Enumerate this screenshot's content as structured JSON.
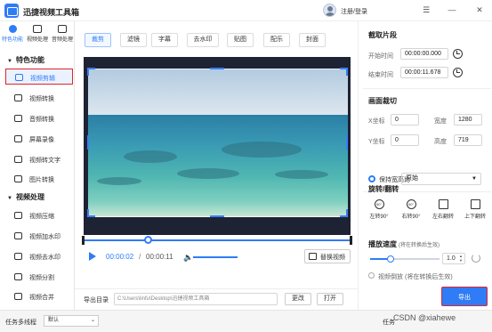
{
  "app": {
    "title": "迅捷视频工具箱",
    "login": "注册/登录"
  },
  "sidebar": {
    "tabs": [
      {
        "label": "特色功能"
      },
      {
        "label": "视频处理"
      },
      {
        "label": "音频处理"
      }
    ],
    "groups": [
      {
        "title": "特色功能",
        "items": [
          "视频剪辑",
          "视频转换",
          "音频转换",
          "屏幕录像",
          "视频转文字",
          "图片转换"
        ]
      },
      {
        "title": "视频处理",
        "items": [
          "视频压缩",
          "视频加水印",
          "视频去水印",
          "视频分割",
          "视频合并"
        ]
      }
    ]
  },
  "toolbar": {
    "tabs": [
      "裁剪",
      "滤镜",
      "字幕",
      "去水印",
      "贴图",
      "配乐",
      "封面"
    ]
  },
  "player": {
    "current_time": "00:00:02",
    "sep": "/",
    "total_time": "00:00:11",
    "replace_label": "替换视频",
    "progress_fraction": 0.24
  },
  "export_dir": {
    "label": "导出目录",
    "path": "C:\\Users\\linfu\\Desktop\\迅捷视频工具箱",
    "change": "更改",
    "open": "打开"
  },
  "right_panel": {
    "clip_section": "截取片段",
    "start_label": "开始时间",
    "start_value": "00:00:00.000",
    "end_label": "结束时间",
    "end_value": "00:00:11.678",
    "crop_section": "画面裁切",
    "x_label": "X坐标",
    "x_value": "0",
    "w_label": "宽度",
    "w_value": "1280",
    "y_label": "Y坐标",
    "y_value": "0",
    "h_label": "高度",
    "h_value": "719",
    "keep_ratio": "保持宽高比",
    "ratio_value": "原始",
    "rotate_section": "旋转/翻转",
    "rotate": [
      "左转90°",
      "右转90°",
      "左右翻转",
      "上下翻转"
    ],
    "rotate_icons": [
      "90°",
      "90°",
      "",
      ""
    ],
    "speed_section": "播放速度",
    "speed_note": "(将在转换后生效)",
    "speed_value": "1.0",
    "speed_fraction": 0.3,
    "reverse_label": "视频倒放",
    "reverse_note": "(将在转换后生效)",
    "export": "导出"
  },
  "status": {
    "multi_label": "任务多线程",
    "multi_value": "默认",
    "task_label": "任务",
    "watermark": "CSDN @xiahewe"
  },
  "colors": {
    "accent": "#2f7cf6",
    "highlight": "#e0242b"
  }
}
